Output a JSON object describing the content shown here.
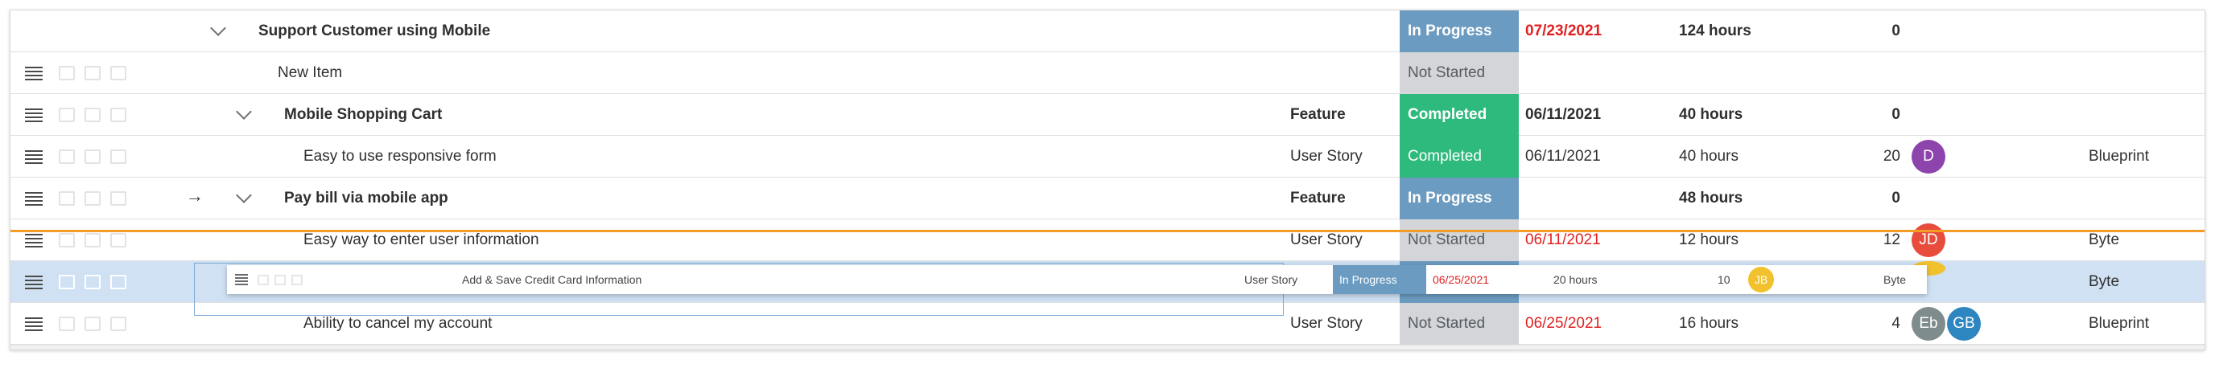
{
  "rows": [
    {
      "title": "Support Customer using Mobile",
      "type": "",
      "status": "In Progress",
      "due": "07/23/2021",
      "hours": "124 hours",
      "count": "0",
      "team": ""
    },
    {
      "title": "New Item",
      "type": "",
      "status": "Not Started",
      "due": "",
      "hours": "",
      "count": "",
      "team": ""
    },
    {
      "title": "Mobile Shopping Cart",
      "type": "Feature",
      "status": "Completed",
      "due": "06/11/2021",
      "hours": "40 hours",
      "count": "0",
      "team": ""
    },
    {
      "title": "Easy to use responsive form",
      "type": "User Story",
      "status": "Completed",
      "due": "06/11/2021",
      "hours": "40 hours",
      "count": "20",
      "team": "Blueprint",
      "avatars": [
        "D"
      ]
    },
    {
      "title": "Pay bill via mobile app",
      "type": "Feature",
      "status": "In Progress",
      "due": "",
      "hours": "48 hours",
      "count": "0",
      "team": ""
    },
    {
      "title": "Easy way to enter user information",
      "type": "User Story",
      "status": "Not Started",
      "due": "06/11/2021",
      "hours": "12 hours",
      "count": "12",
      "team": "Byte",
      "avatars": [
        "JD"
      ]
    },
    {
      "title": "",
      "type": "",
      "status": "In Progress",
      "due": "",
      "hours": "",
      "count": "",
      "team": "Byte"
    },
    {
      "title": "Ability to cancel my account",
      "type": "User Story",
      "status": "Not Started",
      "due": "06/25/2021",
      "hours": "16 hours",
      "count": "4",
      "team": "Blueprint",
      "avatars": [
        "Eb",
        "GB"
      ]
    }
  ],
  "drag_ghost": {
    "title": "Add & Save Credit Card Information",
    "type": "User Story",
    "status": "In Progress",
    "due": "06/25/2021",
    "hours": "20 hours",
    "count": "10",
    "avatar": "JB",
    "team": "Byte"
  },
  "colors": {
    "in_progress": "#6b9bc0",
    "completed": "#2fba7d",
    "not_started": "#d3d5d9",
    "overdue": "#e02020",
    "insert_marker": "#f39c26",
    "selected_row": "#cfe1f3",
    "avatar_D": "#8e44ad",
    "avatar_JD": "#e74c3c",
    "avatar_Eb": "#7f8c8d",
    "avatar_GB": "#2e86c1",
    "avatar_JB": "#f2c12e"
  },
  "icons": [
    "drag-handle-icon",
    "comment-icon",
    "chat-icon",
    "details-icon",
    "chevron-down-icon",
    "arrow-right-icon"
  ]
}
